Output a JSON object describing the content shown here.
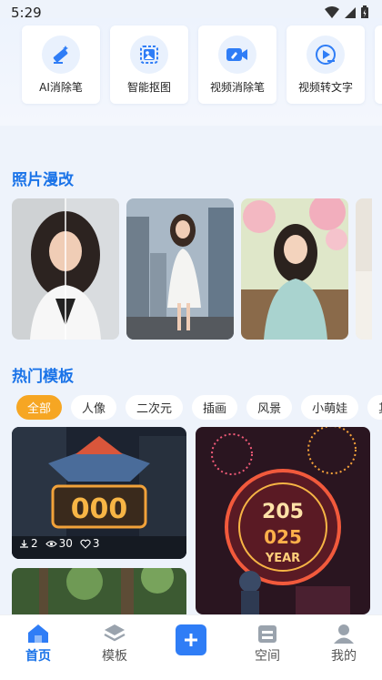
{
  "status": {
    "time": "5:29"
  },
  "tools": [
    {
      "label": "AI消除笔",
      "icon": "magic-pen-icon"
    },
    {
      "label": "智能抠图",
      "icon": "image-cutout-icon"
    },
    {
      "label": "视频消除笔",
      "icon": "video-eraser-icon"
    },
    {
      "label": "视频转文字",
      "icon": "video-to-text-icon"
    }
  ],
  "sections": {
    "photo_title": "照片漫改",
    "templates_title": "热门模板"
  },
  "categories": [
    "全部",
    "人像",
    "二次元",
    "插画",
    "风景",
    "小萌娃",
    "其"
  ],
  "template_stats": {
    "downloads": "2",
    "views": "30",
    "likes": "3"
  },
  "nav": {
    "home": "首页",
    "templates": "模板",
    "space": "空间",
    "mine": "我的"
  },
  "colors": {
    "accent": "#1a73e8",
    "chip_active": "#f6a623",
    "plus": "#2f7df6"
  }
}
